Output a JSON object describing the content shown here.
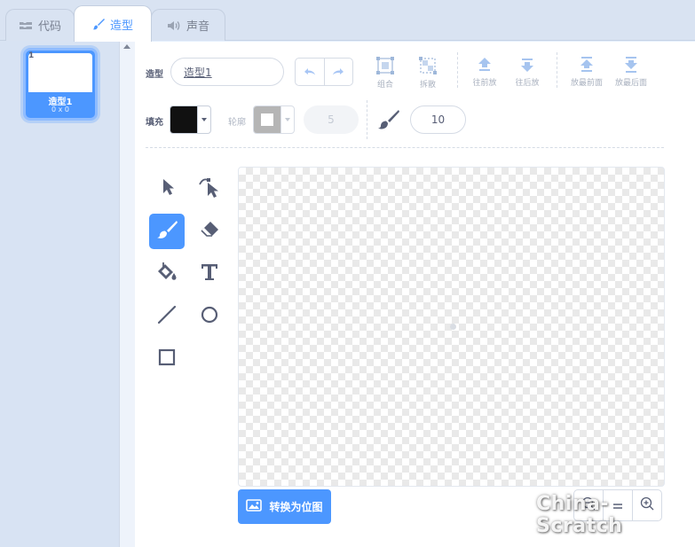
{
  "tabs": [
    {
      "label": "代码",
      "icon": "code-blocks-icon"
    },
    {
      "label": "造型",
      "icon": "brush-icon"
    },
    {
      "label": "声音",
      "icon": "speaker-icon"
    }
  ],
  "costume_list": {
    "items": [
      {
        "number": "1",
        "name": "造型1",
        "size": "0 x 0"
      }
    ]
  },
  "toolbar": {
    "costume_label": "造型",
    "costume_name": "造型1",
    "group_label": "组合",
    "ungroup_label": "拆散",
    "forward_label": "往前放",
    "backward_label": "往后放",
    "front_label": "放最前面",
    "back_label": "放最后面"
  },
  "properties": {
    "fill_label": "填充",
    "fill_color": "#111111",
    "outline_label": "轮廓",
    "outline_color": "#b5b5b5",
    "outline_width": "5",
    "brush_size": "10"
  },
  "tools": [
    "select-tool",
    "reshape-tool",
    "brush-tool",
    "eraser-tool",
    "fill-tool",
    "text-tool",
    "line-tool",
    "circle-tool",
    "rectangle-tool"
  ],
  "selected_tool": "brush-tool",
  "convert_button_label": "转换为位图",
  "zoom": {
    "out": "−",
    "reset": "=",
    "in": "+"
  },
  "watermark": "China-Scratch",
  "colors": {
    "accent": "#4c97ff",
    "text": "#575e75"
  }
}
